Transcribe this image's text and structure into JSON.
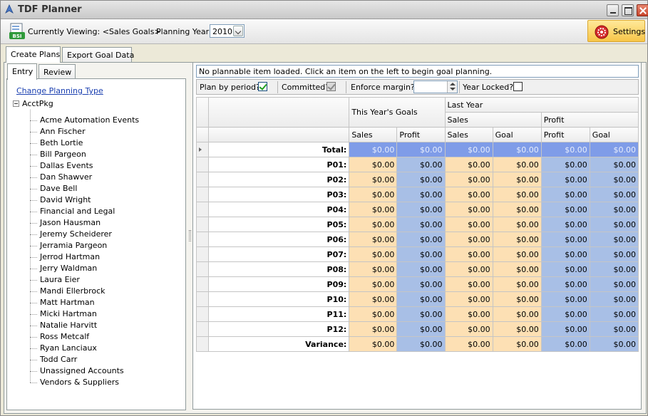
{
  "app": {
    "title": "TDF Planner"
  },
  "toolbar": {
    "viewing_label": "Currently Viewing: <Sales Goals>",
    "planning_year_label": "Planning Year:",
    "planning_year_value": "2010",
    "settings_label": "Settings"
  },
  "tabs": {
    "create_plans": "Create Plans",
    "export_goal_data": "Export Goal Data"
  },
  "left": {
    "tabs": {
      "entry": "Entry",
      "review": "Review"
    },
    "change_planning_type": "Change Planning Type",
    "tree_root": "AcctPkg",
    "items": [
      "Acme Automation Events",
      "Ann Fischer",
      "Beth Lortie",
      "Bill Pargeon",
      "Dallas Events",
      "Dan Shawver",
      "Dave Bell",
      "David Wright",
      "Financial and Legal",
      "Jason Hausman",
      "Jeremy Scheiderer",
      "Jerramia Pargeon",
      "Jerrod Hartman",
      "Jerry Waldman",
      "Laura Eier",
      "Mandi Ellerbrock",
      "Matt Hartman",
      "Micki Hartman",
      "Natalie Harvitt",
      "Ross Metcalf",
      "Ryan Lanciaux",
      "Todd Carr",
      "Unassigned Accounts",
      "Vendors & Suppliers"
    ]
  },
  "main": {
    "status": "No plannable item loaded. Click an item on the left to begin goal planning.",
    "options": {
      "plan_by_period": "Plan by period?",
      "committed": "Committed?",
      "enforce_margin": "Enforce margin?",
      "year_locked": "Year Locked?"
    },
    "grid": {
      "headers": {
        "this_year": "This Year's Goals",
        "last_year": "Last Year",
        "sales": "Sales",
        "profit": "Profit",
        "goal": "Goal"
      },
      "rows": [
        {
          "label": "Total:",
          "values": [
            "$0.00",
            "$0.00",
            "$0.00",
            "$0.00",
            "$0.00",
            "$0.00"
          ]
        },
        {
          "label": "P01:",
          "values": [
            "$0.00",
            "$0.00",
            "$0.00",
            "$0.00",
            "$0.00",
            "$0.00"
          ]
        },
        {
          "label": "P02:",
          "values": [
            "$0.00",
            "$0.00",
            "$0.00",
            "$0.00",
            "$0.00",
            "$0.00"
          ]
        },
        {
          "label": "P03:",
          "values": [
            "$0.00",
            "$0.00",
            "$0.00",
            "$0.00",
            "$0.00",
            "$0.00"
          ]
        },
        {
          "label": "P04:",
          "values": [
            "$0.00",
            "$0.00",
            "$0.00",
            "$0.00",
            "$0.00",
            "$0.00"
          ]
        },
        {
          "label": "P05:",
          "values": [
            "$0.00",
            "$0.00",
            "$0.00",
            "$0.00",
            "$0.00",
            "$0.00"
          ]
        },
        {
          "label": "P06:",
          "values": [
            "$0.00",
            "$0.00",
            "$0.00",
            "$0.00",
            "$0.00",
            "$0.00"
          ]
        },
        {
          "label": "P07:",
          "values": [
            "$0.00",
            "$0.00",
            "$0.00",
            "$0.00",
            "$0.00",
            "$0.00"
          ]
        },
        {
          "label": "P08:",
          "values": [
            "$0.00",
            "$0.00",
            "$0.00",
            "$0.00",
            "$0.00",
            "$0.00"
          ]
        },
        {
          "label": "P09:",
          "values": [
            "$0.00",
            "$0.00",
            "$0.00",
            "$0.00",
            "$0.00",
            "$0.00"
          ]
        },
        {
          "label": "P10:",
          "values": [
            "$0.00",
            "$0.00",
            "$0.00",
            "$0.00",
            "$0.00",
            "$0.00"
          ]
        },
        {
          "label": "P11:",
          "values": [
            "$0.00",
            "$0.00",
            "$0.00",
            "$0.00",
            "$0.00",
            "$0.00"
          ]
        },
        {
          "label": "P12:",
          "values": [
            "$0.00",
            "$0.00",
            "$0.00",
            "$0.00",
            "$0.00",
            "$0.00"
          ]
        },
        {
          "label": "Variance:",
          "values": [
            "$0.00",
            "$0.00",
            "$0.00",
            "$0.00",
            "$0.00",
            "$0.00"
          ]
        }
      ]
    }
  },
  "colors": {
    "goal_cell": "#fde0b4",
    "last_year_cell": "#a8bfe6",
    "total_row": "#7f9ce8",
    "settings_button": "#f7c548"
  }
}
